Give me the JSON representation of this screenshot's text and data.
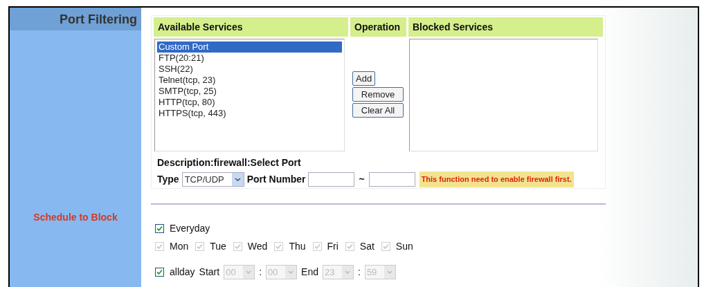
{
  "sidebar": {
    "title": "Port Filtering",
    "section_label": "Schedule to Block"
  },
  "port_filter": {
    "columns": [
      "Available Services",
      "Operation",
      "Blocked Services"
    ],
    "available_services": [
      {
        "label": "Custom Port",
        "selected": true
      },
      {
        "label": "FTP(20:21)",
        "selected": false
      },
      {
        "label": "SSH(22)",
        "selected": false
      },
      {
        "label": "Telnet(tcp, 23)",
        "selected": false
      },
      {
        "label": "SMTP(tcp, 25)",
        "selected": false
      },
      {
        "label": "HTTP(tcp, 80)",
        "selected": false
      },
      {
        "label": "HTTPS(tcp, 443)",
        "selected": false
      }
    ],
    "buttons": [
      "Add",
      "Remove",
      "Clear All"
    ],
    "description": "Description:firewall:Select Port",
    "type_label": "Type",
    "type_value": "TCP/UDP",
    "port_number_label": "Port Number",
    "port_separator": "~",
    "warning": "This function need to enable firewall first."
  },
  "schedule": {
    "everyday": {
      "label": "Everyday",
      "checked": true
    },
    "days": [
      {
        "label": "Mon",
        "checked": true,
        "disabled": true
      },
      {
        "label": "Tue",
        "checked": true,
        "disabled": true
      },
      {
        "label": "Wed",
        "checked": true,
        "disabled": true
      },
      {
        "label": "Thu",
        "checked": true,
        "disabled": true
      },
      {
        "label": "Fri",
        "checked": true,
        "disabled": true
      },
      {
        "label": "Sat",
        "checked": true,
        "disabled": true
      },
      {
        "label": "Sun",
        "checked": true,
        "disabled": true
      }
    ],
    "allday": {
      "label": "allday",
      "checked": true
    },
    "time": [
      {
        "kind": "label",
        "text": "Start"
      },
      {
        "kind": "select",
        "value": "00",
        "disabled": true
      },
      {
        "kind": "separator",
        "text": ":"
      },
      {
        "kind": "select",
        "value": "00",
        "disabled": true
      },
      {
        "kind": "label",
        "text": "End"
      },
      {
        "kind": "select",
        "value": "23",
        "disabled": true
      },
      {
        "kind": "separator",
        "text": ":"
      },
      {
        "kind": "select",
        "value": "59",
        "disabled": true
      }
    ]
  }
}
